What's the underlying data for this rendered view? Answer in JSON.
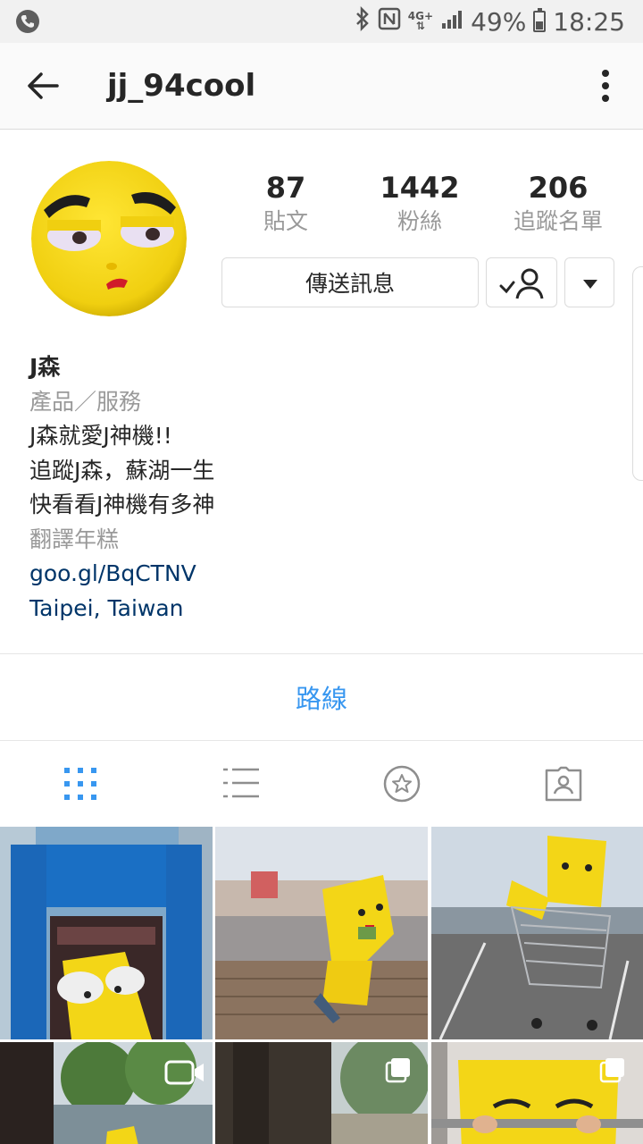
{
  "status_bar": {
    "icons": [
      "phone-icon",
      "bluetooth-icon",
      "nfc-icon",
      "network-4g-icon",
      "signal-icon",
      "battery-icon"
    ],
    "network_label": "4G+",
    "battery_percent": "49%",
    "time": "18:25"
  },
  "app_bar": {
    "username": "jj_94cool"
  },
  "profile": {
    "stats": [
      {
        "value": "87",
        "label": "貼文"
      },
      {
        "value": "1442",
        "label": "粉絲"
      },
      {
        "value": "206",
        "label": "追蹤名單"
      }
    ],
    "message_button": "傳送訊息",
    "bio": {
      "name": "J森",
      "category": "產品／服務",
      "lines": [
        "J森就愛J神機!!",
        "追蹤J森，蘇湖一生",
        "快看看J神機有多神"
      ],
      "translate": "翻譯年糕",
      "link": "goo.gl/BqCTNV",
      "location": "Taipei, Taiwan"
    },
    "directions_label": "路線"
  },
  "tabs": [
    "grid-tab",
    "list-tab",
    "saved-tab",
    "tagged-tab"
  ],
  "colors": {
    "accent_blue": "#3897f0",
    "link_navy": "#003569",
    "mascot_yellow": "#f7d81a"
  }
}
